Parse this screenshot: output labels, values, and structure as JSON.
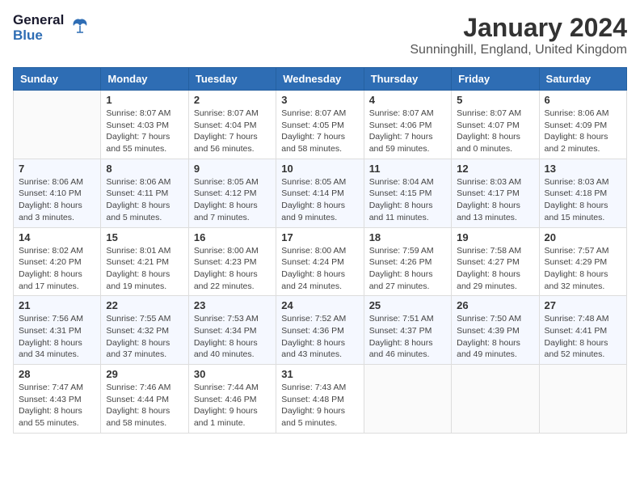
{
  "header": {
    "logo_general": "General",
    "logo_blue": "Blue",
    "title": "January 2024",
    "location": "Sunninghill, England, United Kingdom"
  },
  "days_of_week": [
    "Sunday",
    "Monday",
    "Tuesday",
    "Wednesday",
    "Thursday",
    "Friday",
    "Saturday"
  ],
  "weeks": [
    [
      {
        "day": "",
        "detail": ""
      },
      {
        "day": "1",
        "detail": "Sunrise: 8:07 AM\nSunset: 4:03 PM\nDaylight: 7 hours\nand 55 minutes."
      },
      {
        "day": "2",
        "detail": "Sunrise: 8:07 AM\nSunset: 4:04 PM\nDaylight: 7 hours\nand 56 minutes."
      },
      {
        "day": "3",
        "detail": "Sunrise: 8:07 AM\nSunset: 4:05 PM\nDaylight: 7 hours\nand 58 minutes."
      },
      {
        "day": "4",
        "detail": "Sunrise: 8:07 AM\nSunset: 4:06 PM\nDaylight: 7 hours\nand 59 minutes."
      },
      {
        "day": "5",
        "detail": "Sunrise: 8:07 AM\nSunset: 4:07 PM\nDaylight: 8 hours\nand 0 minutes."
      },
      {
        "day": "6",
        "detail": "Sunrise: 8:06 AM\nSunset: 4:09 PM\nDaylight: 8 hours\nand 2 minutes."
      }
    ],
    [
      {
        "day": "7",
        "detail": "Sunrise: 8:06 AM\nSunset: 4:10 PM\nDaylight: 8 hours\nand 3 minutes."
      },
      {
        "day": "8",
        "detail": "Sunrise: 8:06 AM\nSunset: 4:11 PM\nDaylight: 8 hours\nand 5 minutes."
      },
      {
        "day": "9",
        "detail": "Sunrise: 8:05 AM\nSunset: 4:12 PM\nDaylight: 8 hours\nand 7 minutes."
      },
      {
        "day": "10",
        "detail": "Sunrise: 8:05 AM\nSunset: 4:14 PM\nDaylight: 8 hours\nand 9 minutes."
      },
      {
        "day": "11",
        "detail": "Sunrise: 8:04 AM\nSunset: 4:15 PM\nDaylight: 8 hours\nand 11 minutes."
      },
      {
        "day": "12",
        "detail": "Sunrise: 8:03 AM\nSunset: 4:17 PM\nDaylight: 8 hours\nand 13 minutes."
      },
      {
        "day": "13",
        "detail": "Sunrise: 8:03 AM\nSunset: 4:18 PM\nDaylight: 8 hours\nand 15 minutes."
      }
    ],
    [
      {
        "day": "14",
        "detail": "Sunrise: 8:02 AM\nSunset: 4:20 PM\nDaylight: 8 hours\nand 17 minutes."
      },
      {
        "day": "15",
        "detail": "Sunrise: 8:01 AM\nSunset: 4:21 PM\nDaylight: 8 hours\nand 19 minutes."
      },
      {
        "day": "16",
        "detail": "Sunrise: 8:00 AM\nSunset: 4:23 PM\nDaylight: 8 hours\nand 22 minutes."
      },
      {
        "day": "17",
        "detail": "Sunrise: 8:00 AM\nSunset: 4:24 PM\nDaylight: 8 hours\nand 24 minutes."
      },
      {
        "day": "18",
        "detail": "Sunrise: 7:59 AM\nSunset: 4:26 PM\nDaylight: 8 hours\nand 27 minutes."
      },
      {
        "day": "19",
        "detail": "Sunrise: 7:58 AM\nSunset: 4:27 PM\nDaylight: 8 hours\nand 29 minutes."
      },
      {
        "day": "20",
        "detail": "Sunrise: 7:57 AM\nSunset: 4:29 PM\nDaylight: 8 hours\nand 32 minutes."
      }
    ],
    [
      {
        "day": "21",
        "detail": "Sunrise: 7:56 AM\nSunset: 4:31 PM\nDaylight: 8 hours\nand 34 minutes."
      },
      {
        "day": "22",
        "detail": "Sunrise: 7:55 AM\nSunset: 4:32 PM\nDaylight: 8 hours\nand 37 minutes."
      },
      {
        "day": "23",
        "detail": "Sunrise: 7:53 AM\nSunset: 4:34 PM\nDaylight: 8 hours\nand 40 minutes."
      },
      {
        "day": "24",
        "detail": "Sunrise: 7:52 AM\nSunset: 4:36 PM\nDaylight: 8 hours\nand 43 minutes."
      },
      {
        "day": "25",
        "detail": "Sunrise: 7:51 AM\nSunset: 4:37 PM\nDaylight: 8 hours\nand 46 minutes."
      },
      {
        "day": "26",
        "detail": "Sunrise: 7:50 AM\nSunset: 4:39 PM\nDaylight: 8 hours\nand 49 minutes."
      },
      {
        "day": "27",
        "detail": "Sunrise: 7:48 AM\nSunset: 4:41 PM\nDaylight: 8 hours\nand 52 minutes."
      }
    ],
    [
      {
        "day": "28",
        "detail": "Sunrise: 7:47 AM\nSunset: 4:43 PM\nDaylight: 8 hours\nand 55 minutes."
      },
      {
        "day": "29",
        "detail": "Sunrise: 7:46 AM\nSunset: 4:44 PM\nDaylight: 8 hours\nand 58 minutes."
      },
      {
        "day": "30",
        "detail": "Sunrise: 7:44 AM\nSunset: 4:46 PM\nDaylight: 9 hours\nand 1 minute."
      },
      {
        "day": "31",
        "detail": "Sunrise: 7:43 AM\nSunset: 4:48 PM\nDaylight: 9 hours\nand 5 minutes."
      },
      {
        "day": "",
        "detail": ""
      },
      {
        "day": "",
        "detail": ""
      },
      {
        "day": "",
        "detail": ""
      }
    ]
  ]
}
